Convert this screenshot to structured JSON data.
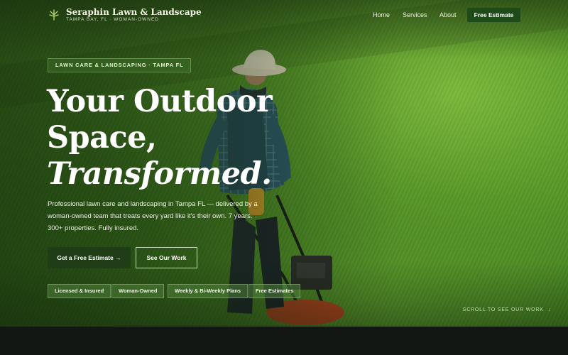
{
  "brand": {
    "name": "Seraphin Lawn & Landscape",
    "tagline": "TAMPA BAY, FL · WOMAN-OWNED",
    "icon": "leaf-sprout-icon"
  },
  "nav": {
    "links": [
      "Home",
      "Services",
      "About"
    ],
    "cta": "Free Estimate"
  },
  "hero": {
    "eyebrow": "LAWN CARE & LANDSCAPING · TAMPA FL",
    "headline": [
      "Your Outdoor",
      "Space,",
      "Transformed."
    ],
    "body": "Professional lawn care and landscaping in Tampa FL — delivered by a woman-owned team that treats every yard like it's their own. 7 years. 300+ properties. Fully insured.",
    "primary_button": "Get a Free Estimate →",
    "secondary_button": "See Our Work",
    "badges": [
      "Licensed & Insured",
      "Woman-Owned",
      "Weekly & Bi-Weekly Plans",
      "Free Estimates"
    ],
    "scroll_hint": "SCROLL TO SEE OUR WORK",
    "scroll_icon": "arrow-down-icon"
  },
  "colors": {
    "accent": "#1f4a1a",
    "button_dark": "#1f3d17",
    "footer": "#131713"
  }
}
